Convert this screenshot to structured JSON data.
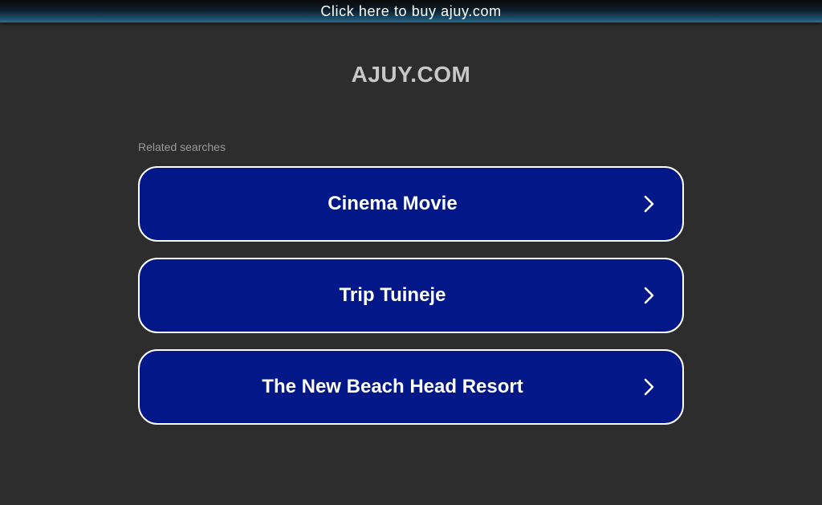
{
  "banner": {
    "text": "Click here to buy ajuy.com"
  },
  "site": {
    "title": "AJUY.COM"
  },
  "related": {
    "heading": "Related searches",
    "items": [
      {
        "label": "Cinema Movie",
        "icon": "chevron-right-icon"
      },
      {
        "label": "Trip Tuineje",
        "icon": "chevron-right-icon"
      },
      {
        "label": "The New Beach Head Resort",
        "icon": "chevron-right-icon"
      }
    ]
  },
  "colors": {
    "background": "#2d2d2d",
    "button": "#021889",
    "button_border": "#ffffff",
    "title": "#c8c8c8",
    "muted": "#9a9a9a"
  }
}
